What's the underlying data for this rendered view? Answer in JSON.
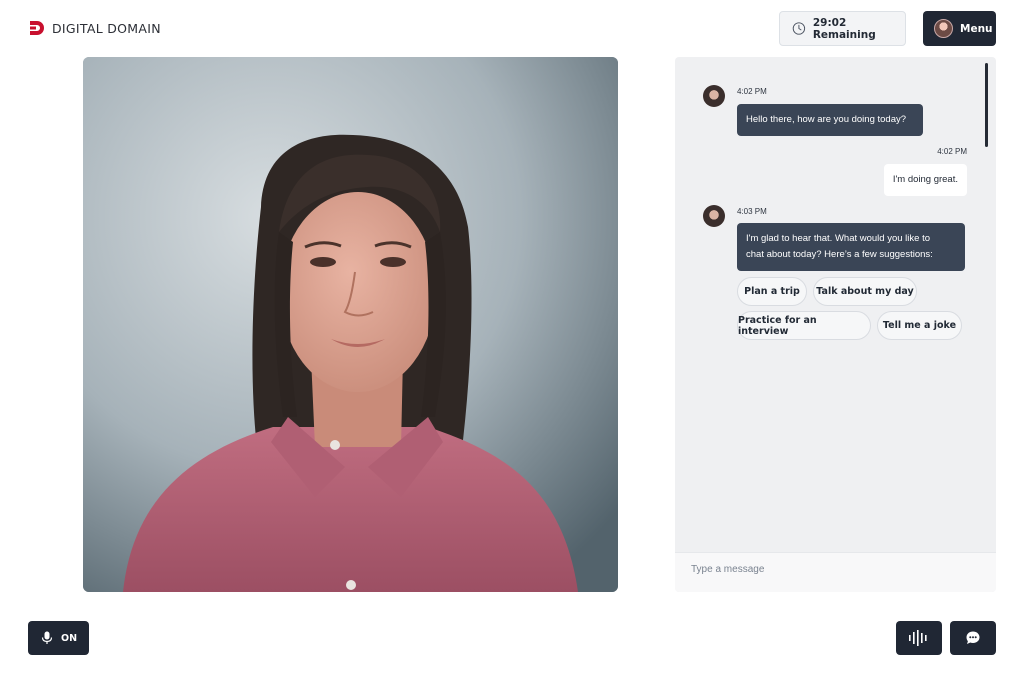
{
  "header": {
    "logo_text": "DIGITAL DOMAIN",
    "timer": {
      "icon": "clock-icon",
      "text": "29:02 Remaining"
    },
    "menu": {
      "label": "Menu",
      "icon": "user-avatar"
    }
  },
  "chat": {
    "messages": [
      {
        "sender": "assistant",
        "time": "4:02 PM",
        "text": "Hello there, how are you doing today?"
      },
      {
        "sender": "user",
        "time": "4:02 PM",
        "text": "I'm doing great."
      },
      {
        "sender": "assistant",
        "time": "4:03 PM",
        "line1": "I'm glad to hear that. What would you like to",
        "line2": "chat about today? Here’s a few suggestions:"
      }
    ],
    "suggestions": [
      "Plan a trip",
      "Talk about my day",
      "Practice for an interview",
      "Tell me a joke"
    ],
    "input_placeholder": "Type a message"
  },
  "controls": {
    "mic": {
      "icon": "microphone-icon",
      "label": "ON"
    },
    "voice_icon": "waveform-icon",
    "chat_icon": "chat-bubble-icon"
  },
  "colors": {
    "brand_red": "#c8102e",
    "dark_button": "#202734",
    "ai_bubble": "#3a4556",
    "chat_bg": "#eff0f2"
  }
}
